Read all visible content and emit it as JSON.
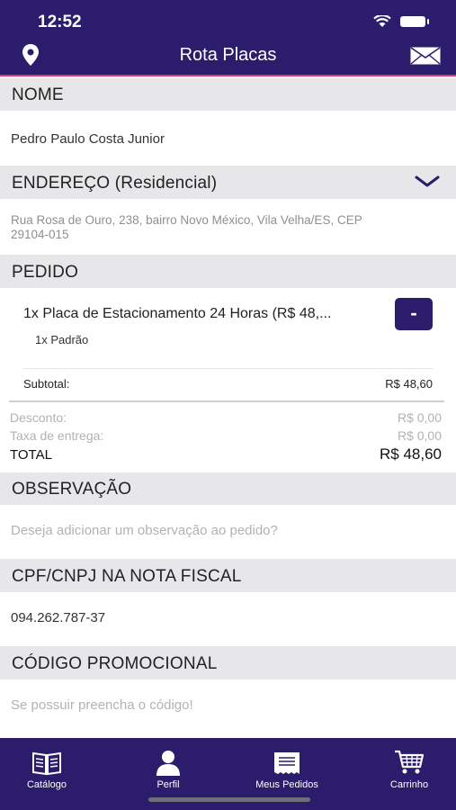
{
  "status_bar": {
    "time": "12:52"
  },
  "header": {
    "title": "Rota Placas"
  },
  "nome": {
    "heading": "NOME",
    "value": "Pedro Paulo Costa Junior"
  },
  "endereco": {
    "heading": "ENDEREÇO (Residencial)",
    "line1": "Rua Rosa de Ouro, 238, bairro Novo México, Vila Velha/ES, CEP",
    "line2": "29104-015"
  },
  "pedido": {
    "heading": "PEDIDO",
    "item": "1x Placa de Estacionamento 24 Horas (R$ 48,...",
    "item_option": "1x Padrão",
    "remove_label": "-",
    "subtotal_label": "Subtotal:",
    "subtotal_value": "R$ 48,60",
    "desconto_label": "Desconto:",
    "desconto_value": "R$ 0,00",
    "entrega_label": "Taxa de entrega:",
    "entrega_value": "R$ 0,00",
    "total_label": "TOTAL",
    "total_value": "R$ 48,60"
  },
  "observacao": {
    "heading": "OBSERVAÇÃO",
    "placeholder": "Deseja adicionar um observação ao pedido?"
  },
  "cpf": {
    "heading": "CPF/CNPJ NA NOTA FISCAL",
    "value": "094.262.787-37"
  },
  "promo": {
    "heading": "CÓDIGO PROMOCIONAL",
    "placeholder": "Se possuir preencha o código!"
  },
  "tabs": [
    {
      "label": "Catálogo",
      "icon": "book-icon"
    },
    {
      "label": "Perfil",
      "icon": "user-icon"
    },
    {
      "label": "Meus Pedidos",
      "icon": "receipt-icon"
    },
    {
      "label": "Carrinho",
      "icon": "cart-icon"
    }
  ],
  "colors": {
    "primary": "#2b1d6b",
    "accent": "#e5356f",
    "section_bg": "#e7e7e9"
  }
}
